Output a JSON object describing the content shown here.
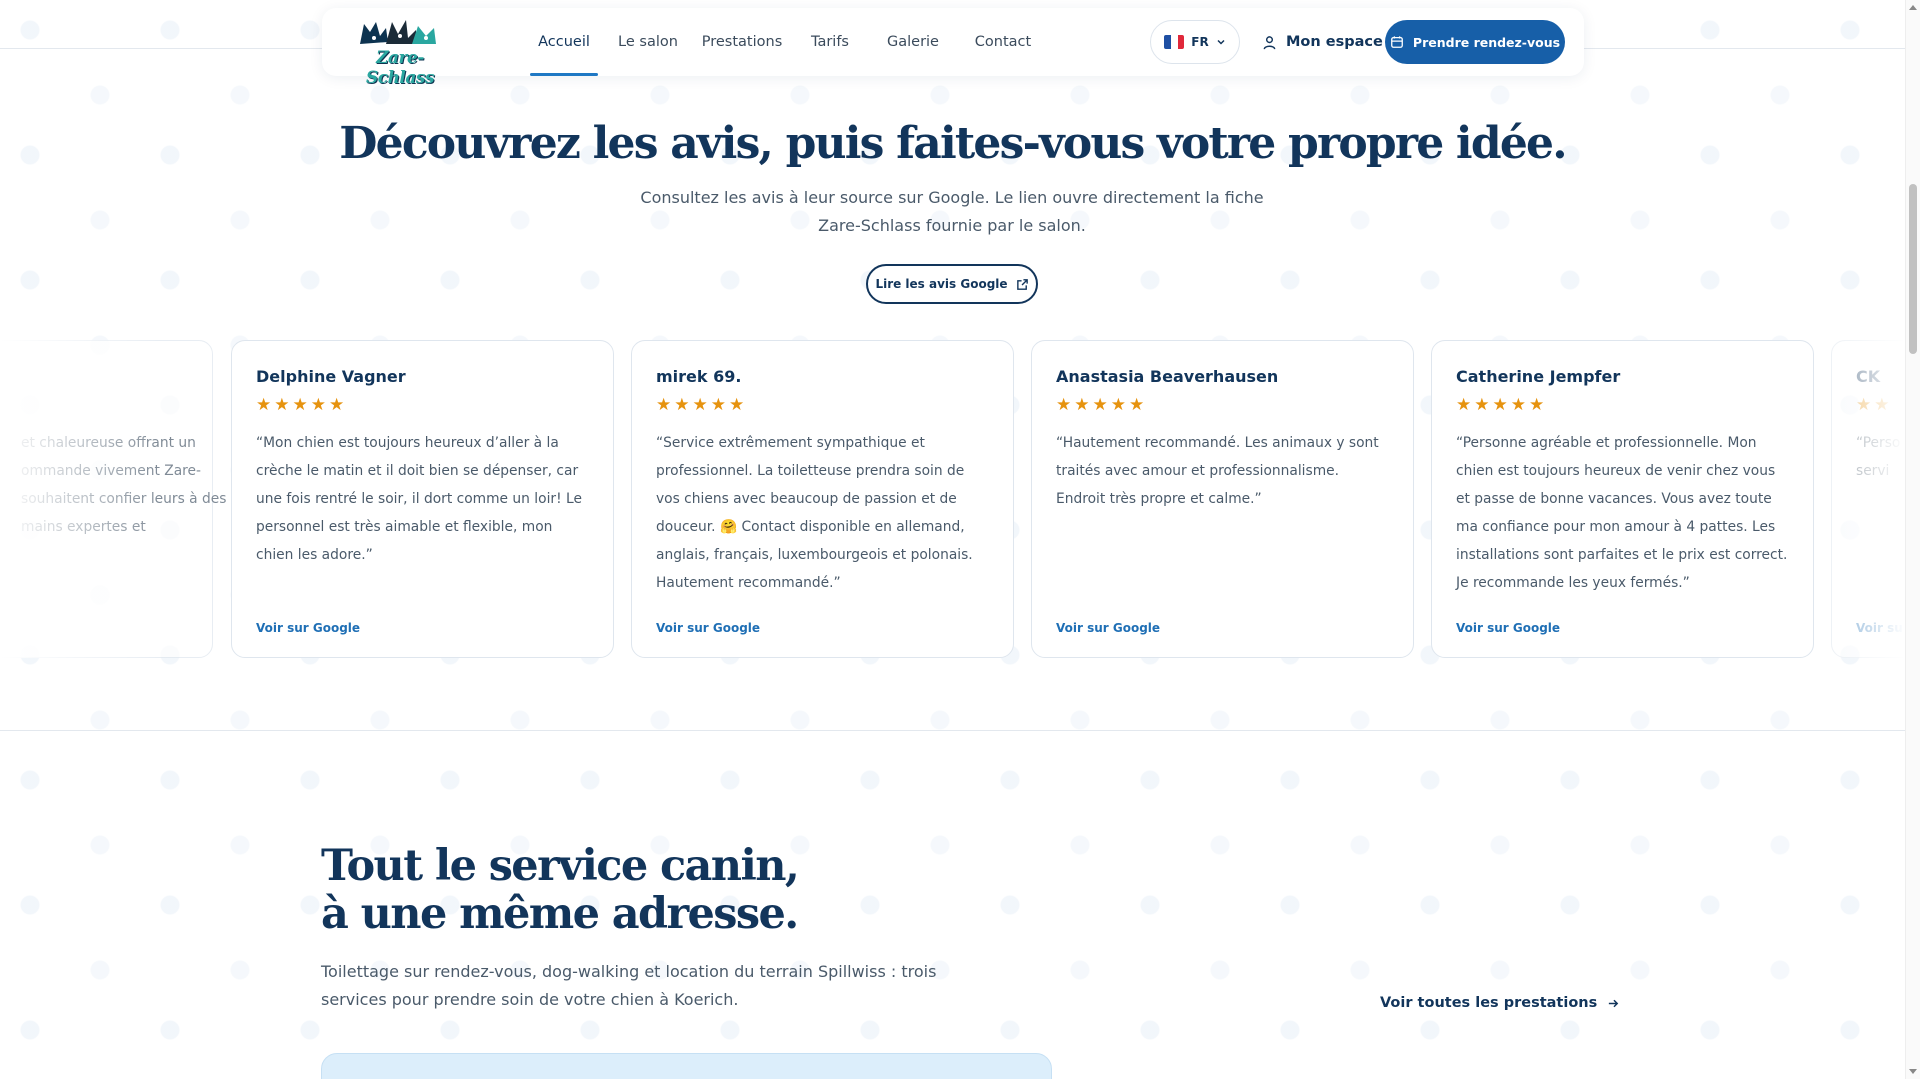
{
  "brand": {
    "logo_text": "Zare-Schlass"
  },
  "nav": {
    "items": [
      {
        "label": "Accueil",
        "active": true
      },
      {
        "label": "Le salon"
      },
      {
        "label": "Prestations"
      },
      {
        "label": "Tarifs"
      },
      {
        "label": "Galerie"
      },
      {
        "label": "Contact"
      }
    ],
    "lang_code": "FR",
    "account_label": "Mon espace",
    "cta_label": "Prendre rendez-vous"
  },
  "reviews": {
    "title": "Découvrez les avis, puis faites-vous votre propre idée.",
    "subtitle": "Consultez les avis à leur source sur Google. Le lien ouvre directement la fiche Zare-Schlass fournie par le salon.",
    "google_button": "Lire les avis Google",
    "partial_left_text": "et chaleureuse offrant un ommande vivement Zare- souhaitent confier leurs à des mains expertes et",
    "cards": [
      {
        "name": "Delphine Vagner",
        "stars": 5,
        "text": "“Mon chien est toujours heureux d’aller à la crèche le matin et il doit bien se dépenser, car une fois rentré le soir, il dort comme un loir! Le personnel est très aimable et flexible, mon chien les adore.”",
        "link": "Voir sur Google"
      },
      {
        "name": "mirek 69.",
        "stars": 5,
        "text": "“Service extrêmement sympathique et professionnel. La toiletteuse prendra soin de vos chiens avec beaucoup de passion et de douceur. 🤗 Contact disponible en allemand, anglais, français, luxembourgeois et polonais. Hautement recommandé.”",
        "link": "Voir sur Google"
      },
      {
        "name": "Anastasia Beaverhausen",
        "stars": 5,
        "text": "“Hautement recommandé. Les animaux y sont traités avec amour et professionnalisme. Endroit très propre et calme.”",
        "link": "Voir sur Google"
      },
      {
        "name": "Catherine Jempfer",
        "stars": 5,
        "text": "“Personne agréable et professionnelle. Mon chien est toujours heureux de venir chez vous et passe de bonne vacances. Vous avez toute ma confiance pour mon amour à 4 pattes. Les installations sont parfaites et le prix est correct. Je recommande les yeux fermés.”",
        "link": "Voir sur Google"
      }
    ],
    "partial_right": {
      "name": "CK",
      "text": "“Perso servi",
      "link": "Voir su"
    }
  },
  "services": {
    "title_line1": "Tout le service canin,",
    "title_line2": "à une même adresse.",
    "subtitle": "Toilettage sur rendez-vous, dog-walking et location du terrain Spillwiss : trois services pour prendre soin de votre chien à Koerich.",
    "all_link": "Voir toutes les prestations"
  },
  "colors": {
    "primary": "#175fa8",
    "heading": "#12355b",
    "star": "#e6930f",
    "link": "#1f6fb5",
    "flag_blue": "#1e4fa3",
    "flag_white": "#ffffff",
    "flag_red": "#e0283a"
  },
  "icons": {
    "account": "user-icon",
    "cta": "calendar-icon",
    "lang": "chevron-down-icon",
    "google": "external-link-icon",
    "all_services": "arrow-right-icon",
    "star": "star-icon"
  }
}
